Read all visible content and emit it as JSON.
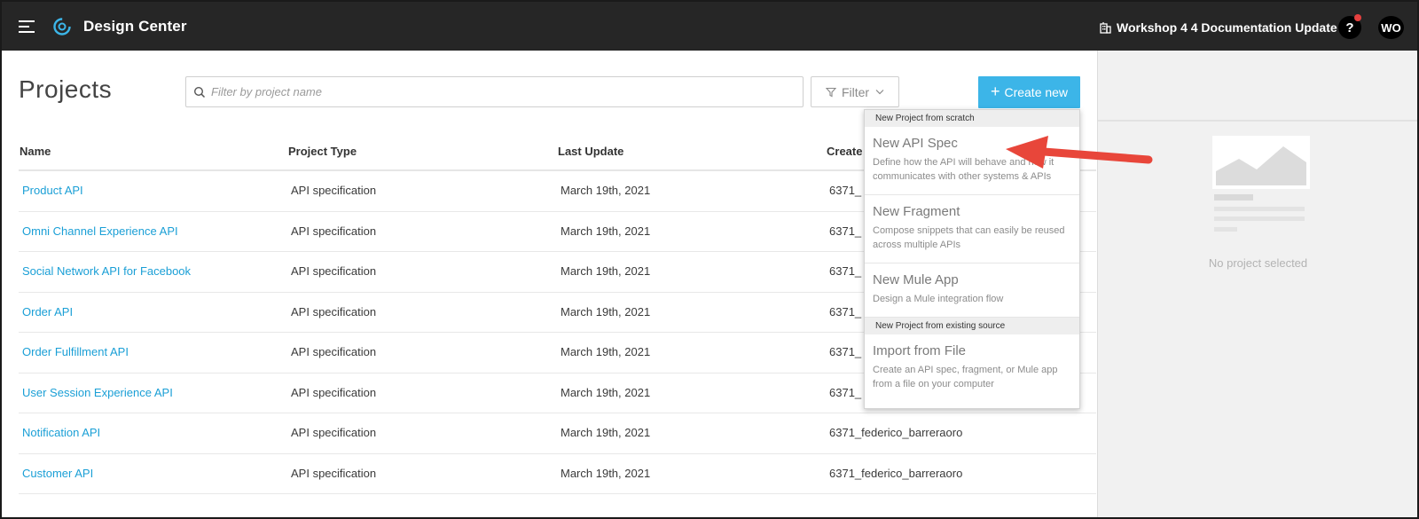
{
  "topbar": {
    "menu_icon": "hamburger-menu-icon",
    "logo_icon": "design-center-logo-icon",
    "app_title": "Design Center",
    "org_icon": "building-icon",
    "org_name": "Workshop 4 4 Documentation Update",
    "help_label": "?",
    "avatar_initials": "WO"
  },
  "main": {
    "title": "Projects",
    "search": {
      "placeholder": "Filter by project name",
      "value": "",
      "icon": "search-icon"
    },
    "filter": {
      "label": "Filter",
      "icon": "funnel-icon",
      "chevron": "chevron-down-icon"
    },
    "create": {
      "label": "Create new",
      "icon": "plus-icon"
    }
  },
  "table": {
    "columns": [
      "Name",
      "Project Type",
      "Last Update",
      "Create"
    ],
    "rows": [
      {
        "name": "Product API",
        "type": "API specification",
        "updated": "March 19th, 2021",
        "creator": "6371_"
      },
      {
        "name": "Omni Channel Experience API",
        "type": "API specification",
        "updated": "March 19th, 2021",
        "creator": "6371_"
      },
      {
        "name": "Social Network API for Facebook",
        "type": "API specification",
        "updated": "March 19th, 2021",
        "creator": "6371_"
      },
      {
        "name": "Order API",
        "type": "API specification",
        "updated": "March 19th, 2021",
        "creator": "6371_"
      },
      {
        "name": "Order Fulfillment API",
        "type": "API specification",
        "updated": "March 19th, 2021",
        "creator": "6371_"
      },
      {
        "name": "User Session Experience API",
        "type": "API specification",
        "updated": "March 19th, 2021",
        "creator": "6371_"
      },
      {
        "name": "Notification API",
        "type": "API specification",
        "updated": "March 19th, 2021",
        "creator": "6371_federico_barreraoro"
      },
      {
        "name": "Customer API",
        "type": "API specification",
        "updated": "March 19th, 2021",
        "creator": "6371_federico_barreraoro"
      }
    ]
  },
  "dropdown": {
    "section_scratch": "New Project from scratch",
    "items_scratch": [
      {
        "title": "New API Spec",
        "desc": "Define how the API will behave and how it communicates with other systems & APIs"
      },
      {
        "title": "New Fragment",
        "desc": "Compose snippets that can easily be reused across multiple APIs"
      },
      {
        "title": "New Mule App",
        "desc": "Design a Mule integration flow"
      }
    ],
    "section_existing": "New Project from existing source",
    "items_existing": [
      {
        "title": "Import from File",
        "desc": "Create an API spec, fragment, or Mule app from a file on your computer"
      }
    ]
  },
  "side_panel": {
    "placeholder_icon": "chart-placeholder-icon",
    "empty_text": "No project selected"
  },
  "annotation": {
    "arrow_icon": "red-arrow-icon",
    "color": "#e8463a"
  },
  "colors": {
    "topbar": "#262626",
    "accent": "#3cb5e8",
    "link": "#1a9fd6"
  }
}
